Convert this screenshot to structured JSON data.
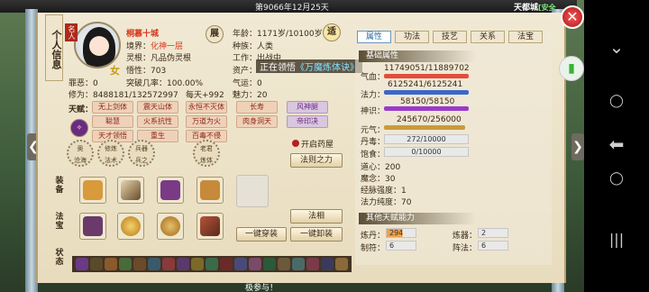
{
  "topbar": {
    "date": "第9066年12月25天",
    "city": "天都城",
    "safe": "[安全"
  },
  "character": {
    "role": "名人",
    "name": "桐慕十城",
    "gender_icon": "女",
    "realm_label": "境界：",
    "realm": "化神一层",
    "root_label": "灵根：",
    "root": "凡品伪灵根",
    "wuxing_label": "悟性：",
    "wuxing": "703",
    "evil_label": "罪恶：",
    "evil": "0",
    "break_label": "突破几率：",
    "break": "100.00%",
    "cult_label": "修为：",
    "cult": "8488181/132572997",
    "daily_label": "每天+",
    "daily": "992",
    "age_label": "年龄：",
    "age": "1171岁/10100岁",
    "race_label": "种族：",
    "race": "人类",
    "work_label": "工作：",
    "work": "出战中",
    "asset_label": "资产：",
    "qi_label": "气运：",
    "qi": "0",
    "charm_label": "魅力：",
    "charm": "20"
  },
  "tooltip": {
    "prefix": "正在领悟",
    "item": "《万魔炼体诀》"
  },
  "seals": {
    "show": "展",
    "move": "适"
  },
  "talents": {
    "label": "天赋：",
    "items": [
      "无上剑体",
      "震天山体",
      "永恒不灭体",
      "长寿",
      "风神腿",
      "聪慧",
      "火系抗性",
      "万道为火",
      "肉身洞天",
      "帝印决",
      "天才领悟",
      "重生",
      "百毒不侵",
      "",
      "",
      "",
      "",
      "",
      "",
      ""
    ]
  },
  "skills": {
    "items": [
      {
        "l1": "奥",
        "l2": "沧海"
      },
      {
        "l1": "修炼",
        "l2": "法术"
      },
      {
        "l1": "兵器",
        "l2": "兵之"
      },
      {
        "l1": "老君",
        "l2": "炼体"
      }
    ]
  },
  "open_furnace": "开启药屋",
  "law_button": "法则之力",
  "faxiang_button": "法相",
  "oneclick_wear": "一键穿装",
  "oneclick_remove": "一键卸装",
  "labels": {
    "equip": "装备",
    "treasure": "法宝",
    "status": "状态",
    "portrait": "个人信息"
  },
  "tabs": [
    "属性",
    "功法",
    "技艺",
    "关系",
    "法宝"
  ],
  "base": {
    "title": "基础属性",
    "qixue_label": "气血：",
    "qixue": "11749051/11889702",
    "fali_label": "法力：",
    "fali": "6125241/6125241",
    "shenshi_label": "神识：",
    "shenshi": "58150/58150",
    "yuanqi_label": "元气：",
    "yuanqi": "245670/256000",
    "dandu_label": "丹毒：",
    "dandu": "272/10000",
    "baoshi_label": "饱食：",
    "baoshi": "0/10000",
    "daoxin_label": "道心：",
    "daoxin": "200",
    "monian_label": "魔念：",
    "monian": "30",
    "jingmai_label": "经脉强度：",
    "jingmai": "1",
    "chundu_label": "法力纯度：",
    "chundu": "70"
  },
  "other": {
    "title": "其他天赋能力",
    "liandan_label": "炼丹：",
    "liandan": "294",
    "lianqi_label": "炼器：",
    "lianqi": "2",
    "zhifu_label": "制符：",
    "zhifu": "6",
    "zhenfa_label": "阵法：",
    "zhenfa": "6"
  },
  "bottom_text": "极参与！",
  "colors": {
    "hp": "#e34d3b",
    "mp": "#3b67c9",
    "shen": "#9b3bc9",
    "yuan": "#c99b3b",
    "accent": "#d5371d"
  }
}
